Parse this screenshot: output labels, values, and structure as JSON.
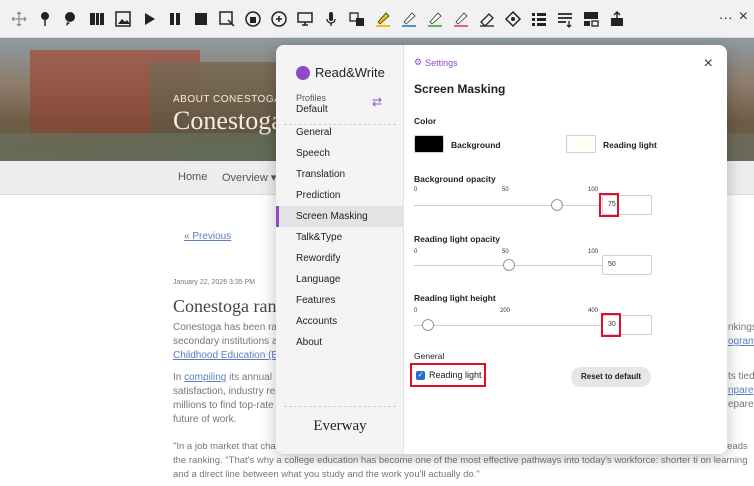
{
  "toolbar": {
    "icons": [
      "move-icon",
      "pin-icon",
      "talk-icon",
      "book-icon",
      "picture-icon",
      "play-icon",
      "pause-icon",
      "stop-icon",
      "screenshot-reader-icon",
      "audio-maker-icon",
      "voice-note-icon",
      "text-icon",
      "microphone-icon",
      "translate-icon",
      "highlight-yellow-icon",
      "highlight-blue-icon",
      "highlight-green-icon",
      "highlight-pink-icon",
      "clear-highlights-icon",
      "collect-highlights-icon",
      "vocabulary-icon",
      "simplify-icon",
      "screen-mask-icon",
      "practice-reading-icon"
    ],
    "more_label": "···",
    "close_label": "×"
  },
  "site": {
    "hero_sub": "ABOUT CONESTOGA",
    "hero_title": "Conestoga",
    "nav_home": "Home",
    "nav_overview": "Overview ▾",
    "prev_link": "« Previous",
    "date": "January 22, 2026 3:35 PM",
    "article_title": "Conestoga rank",
    "p1_line1": "Conestoga has been ran",
    "p1_line2": "secondary institutions a",
    "p1_line3": "Childhood Education (E",
    "p2_line1_prefix": "In ",
    "p2_line1_link": "compiling",
    "p2_line1_suffix": " its annual",
    "p2_line2": "satisfaction, industry re",
    "p2_line3": "millions to find top-rate",
    "p2_line4": "future of work.",
    "p3_text": "\"In a job market that changes faster than most people can retrain on their own, employers want skills that are current, practical and reads the ranking. \"That's why a college education has become one of the most effective pathways into today's workforce: shorter ti on learning and a direct line between what you study and the work you'll actually do.\"",
    "right_kings": "nkings",
    "right_program": "ogram",
    "right_tied": "ts tied",
    "right_npare": "npare",
    "right_epare": "epare"
  },
  "dialog": {
    "logo": "Read&Write",
    "profiles_label": "Profiles",
    "profiles_value": "Default",
    "menu": [
      "General",
      "Speech",
      "Translation",
      "Prediction",
      "Screen Masking",
      "Talk&Type",
      "Rewordify",
      "Language",
      "Features",
      "Accounts",
      "About"
    ],
    "active_menu": "Screen Masking",
    "brand_footer": "Everway",
    "crumb": "Settings",
    "close_label": "×",
    "title": "Screen Masking",
    "color_label": "Color",
    "background_label": "Background",
    "background_color": "#000000",
    "reading_light_label": "Reading light",
    "reading_light_color": "#fefdf6",
    "bg_opacity": {
      "label": "Background opacity",
      "min": "0",
      "mid": "50",
      "max": "100",
      "value": "75",
      "fraction": 0.75
    },
    "rl_opacity": {
      "label": "Reading light opacity",
      "min": "0",
      "mid": "50",
      "max": "100",
      "value": "50",
      "fraction": 0.5
    },
    "rl_height": {
      "label": "Reading light height",
      "min": "0",
      "mid": "200",
      "max": "400",
      "value": "30",
      "fraction": 0.075
    },
    "general_label": "General",
    "reading_light_checkbox": "Reading light",
    "reset_label": "Reset to default"
  },
  "accent_color": "#8f4bc7",
  "highlight_color": "#e0102a"
}
